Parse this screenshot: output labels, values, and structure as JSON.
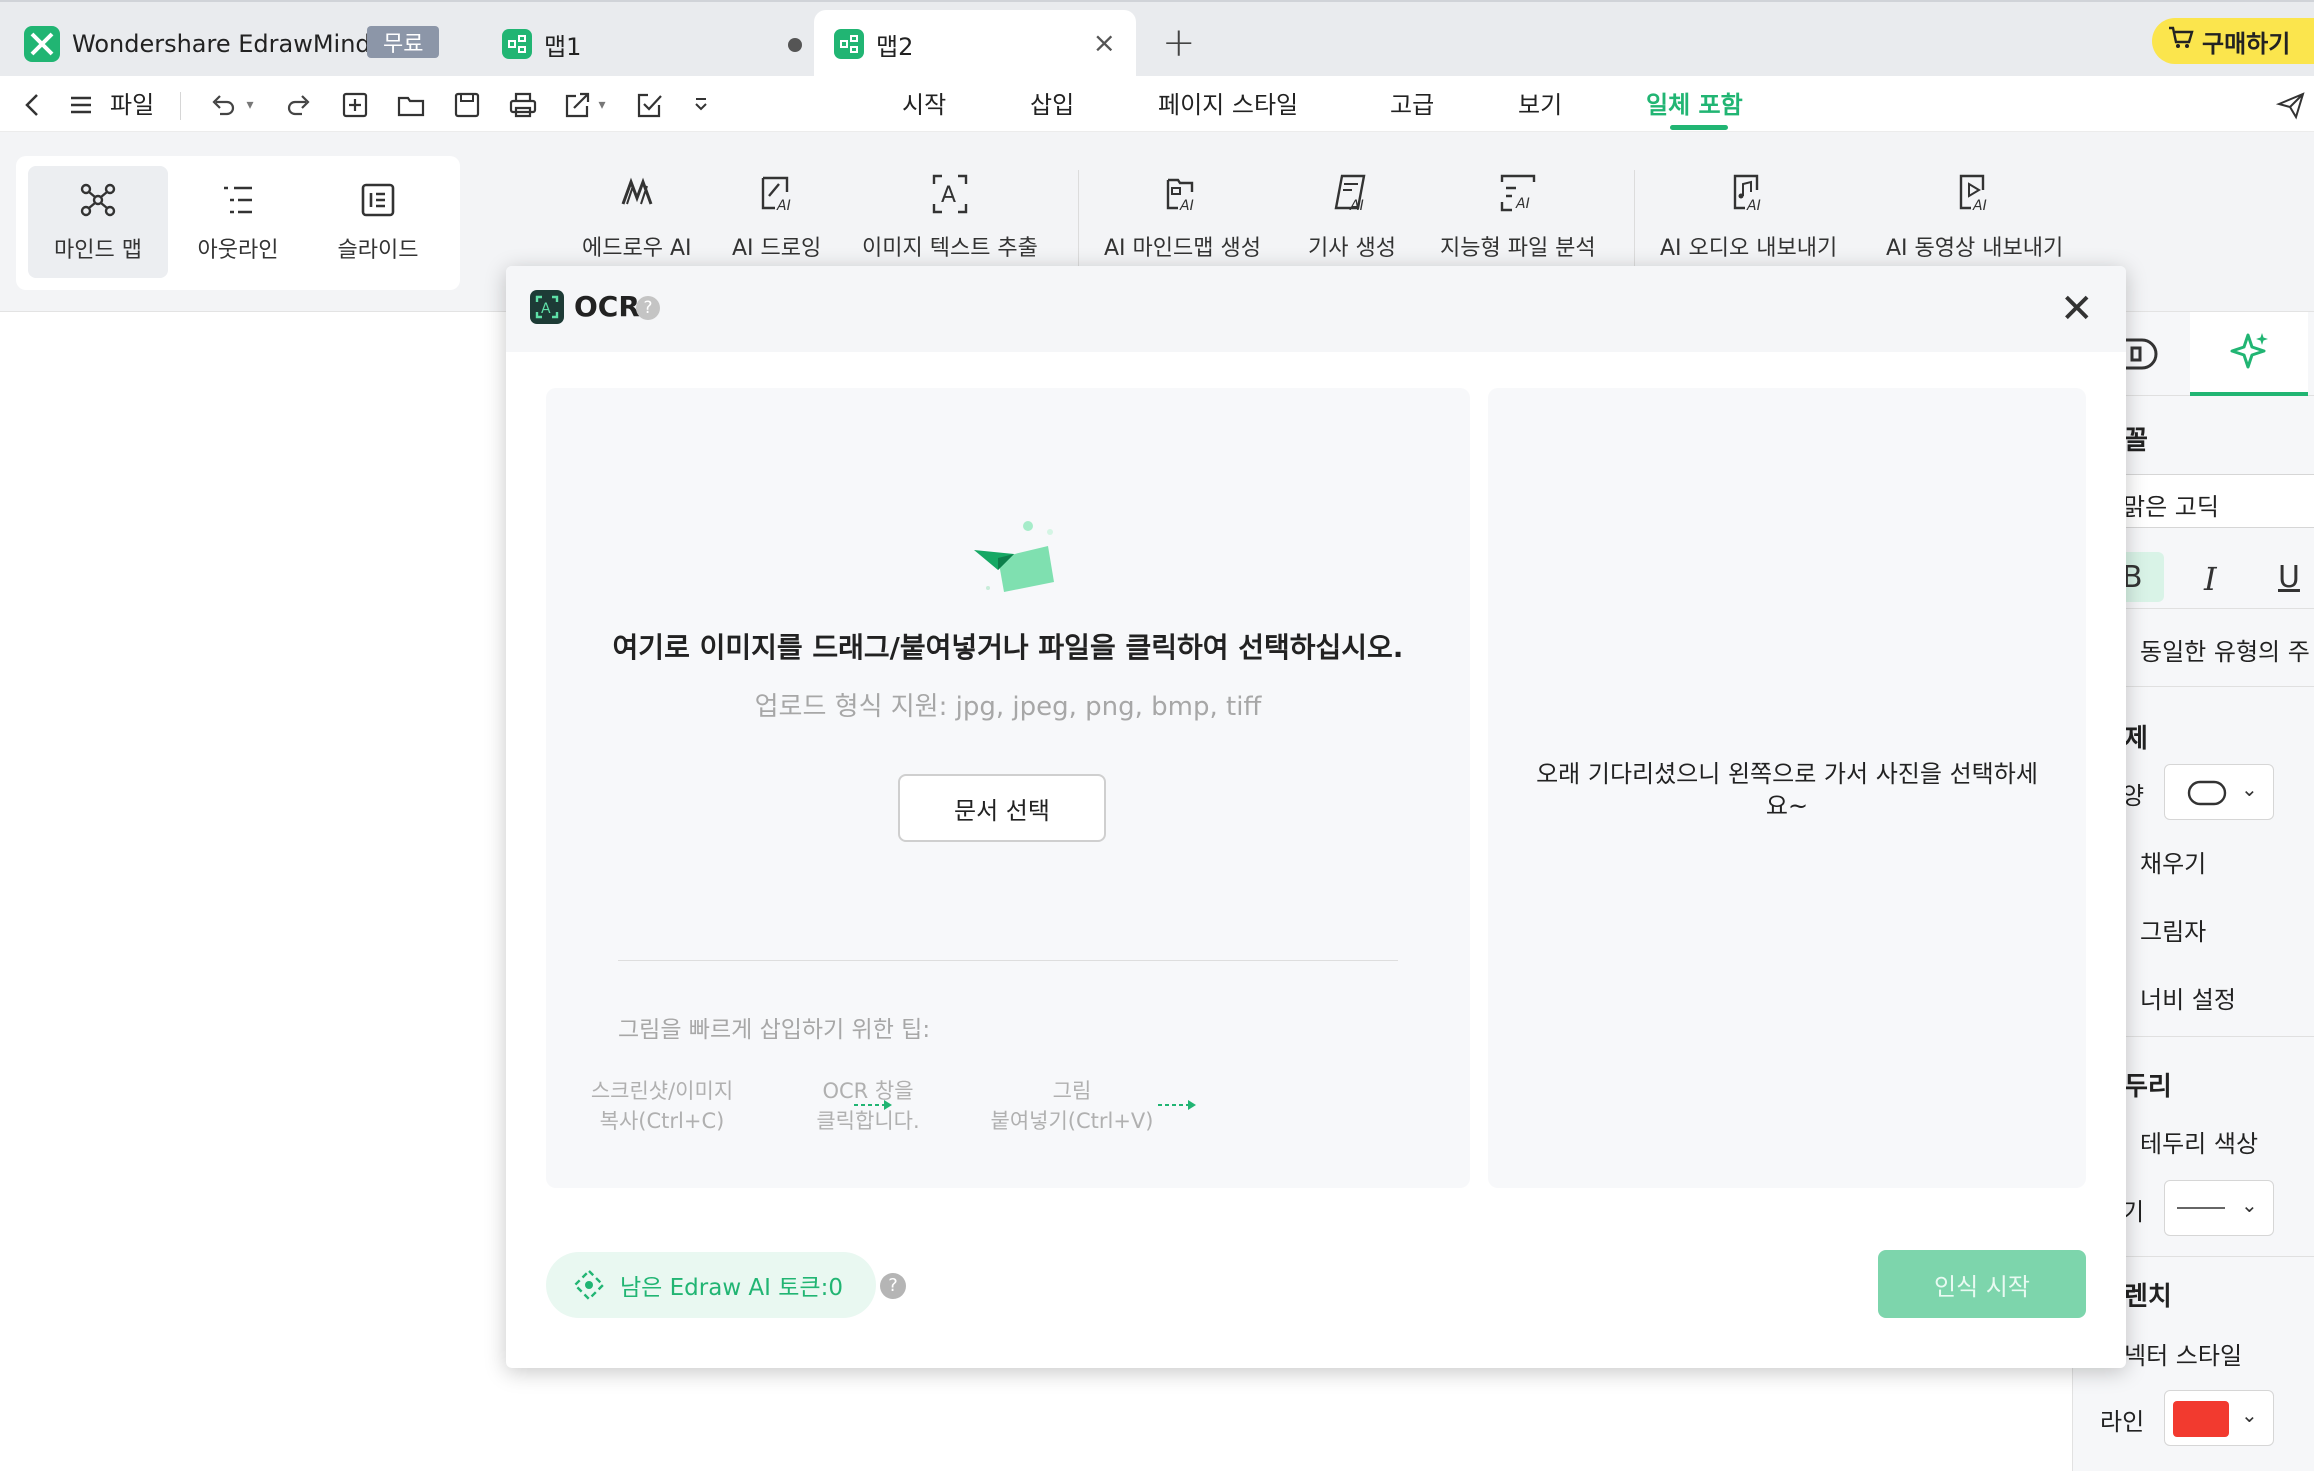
{
  "titlebar": {
    "app_name": "Wondershare EdrawMind",
    "free_badge": "무료",
    "tabs": [
      {
        "label": "맵1"
      },
      {
        "label": "맵2"
      }
    ],
    "buy_label": "구매하기"
  },
  "toolbar": {
    "file_label": "파일",
    "menus": [
      "시작",
      "삽입",
      "페이지 스타일",
      "고급",
      "보기",
      "일체 포함"
    ]
  },
  "ribbon": {
    "views": [
      "마인드 맵",
      "아웃라인",
      "슬라이드"
    ],
    "ai_tools": [
      "에드로우 AI",
      "AI 드로잉",
      "이미지 텍스트 추출",
      "AI 마인드맵 생성",
      "기사 생성",
      "지능형 파일 분석",
      "AI 오디오 내보내기",
      "AI 동영상 내보내기"
    ]
  },
  "right_panel": {
    "font_head": "꼴",
    "font_value": "맑은 고딕",
    "bold": "B",
    "italic": "I",
    "underline": "U",
    "same_type": "동일한 유형의 주",
    "theme_head": "제",
    "shape_label": "양",
    "fill": "채우기",
    "shadow": "그림자",
    "width_setting": "너비 설정",
    "border_head": "두리",
    "border_color": "테두리 색상",
    "thickness_label": "기",
    "branch_head": "렌치",
    "connector_style": "넥터 스타일",
    "line_label": "라인",
    "line_color": "#f23a2f"
  },
  "ocr_dialog": {
    "title": "OCR",
    "help": "?",
    "drop_text": "여기로 이미지를 드래그/붙여넣거나 파일을 클릭하여 선택하십시오.",
    "format_text": "업로드 형식 지원: jpg, jpeg, png, bmp, tiff",
    "choose_button": "문서 선택",
    "tips_title": "그림을 빠르게 삽입하기 위한 팁:",
    "tips": [
      {
        "line1": "스크린샷/이미지",
        "line2": "복사(Ctrl+C)"
      },
      {
        "line1": "OCR 창을",
        "line2": "클릭합니다."
      },
      {
        "line1": "그림",
        "line2": "붙여넣기(Ctrl+V)"
      }
    ],
    "wait_text": "오래 기다리셨으니 왼쪽으로 가서 사진을 선택하세요~",
    "token_label": "남은 Edraw AI 토큰:0",
    "start_button": "인식 시작"
  },
  "colors": {
    "accent": "#21b573",
    "buy": "#fbe54d"
  }
}
